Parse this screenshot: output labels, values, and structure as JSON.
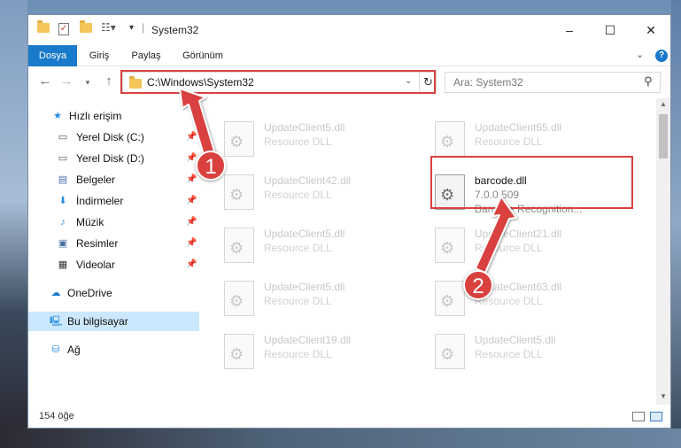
{
  "window": {
    "title": "System32"
  },
  "ribbon": {
    "tabs": [
      "Dosya",
      "Giriş",
      "Paylaş",
      "Görünüm"
    ]
  },
  "nav": {
    "address": "C:\\Windows\\System32",
    "search_placeholder": "Ara: System32"
  },
  "sidebar": {
    "items": [
      {
        "label": "Hızlı erişim",
        "icon": "star-icon"
      },
      {
        "label": "Yerel Disk (C:)",
        "icon": "drive-icon"
      },
      {
        "label": "Yerel Disk (D:)",
        "icon": "drive-icon"
      },
      {
        "label": "Belgeler",
        "icon": "documents-icon"
      },
      {
        "label": "İndirmeler",
        "icon": "download-icon"
      },
      {
        "label": "Müzik",
        "icon": "music-icon"
      },
      {
        "label": "Resimler",
        "icon": "pictures-icon"
      },
      {
        "label": "Videolar",
        "icon": "video-icon"
      },
      {
        "label": "OneDrive",
        "icon": "cloud-icon"
      },
      {
        "label": "Bu bilgisayar",
        "icon": "computer-icon"
      },
      {
        "label": "Ağ",
        "icon": "network-icon"
      }
    ]
  },
  "files": [
    {
      "name": "UpdateClient5.dll",
      "desc": "Resource DLL"
    },
    {
      "name": "UpdateClient65.dll",
      "desc": "Resource DLL"
    },
    {
      "name": "UpdateClient42.dll",
      "desc": "Resource DLL"
    },
    {
      "name": "barcode.dll",
      "desc": "7.0.0.509",
      "desc2": "Barcode Recognition..."
    },
    {
      "name": "UpdateClient5.dll",
      "desc": "Resource DLL"
    },
    {
      "name": "UpdateClient21.dll",
      "desc": "Resource DLL"
    },
    {
      "name": "UpdateClient5.dll",
      "desc": "Resource DLL"
    },
    {
      "name": "UpdateClient63.dll",
      "desc": "Resource DLL"
    },
    {
      "name": "UpdateClient19.dll",
      "desc": "Resource DLL"
    },
    {
      "name": "UpdateClient5.dll",
      "desc": "Resource DLL"
    }
  ],
  "status": {
    "count": "154 öğe"
  },
  "annotations": {
    "step1": "1",
    "step2": "2",
    "color": "#d9413f"
  },
  "colors": {
    "accent": "#1979ca",
    "selection": "#cce8ff"
  }
}
